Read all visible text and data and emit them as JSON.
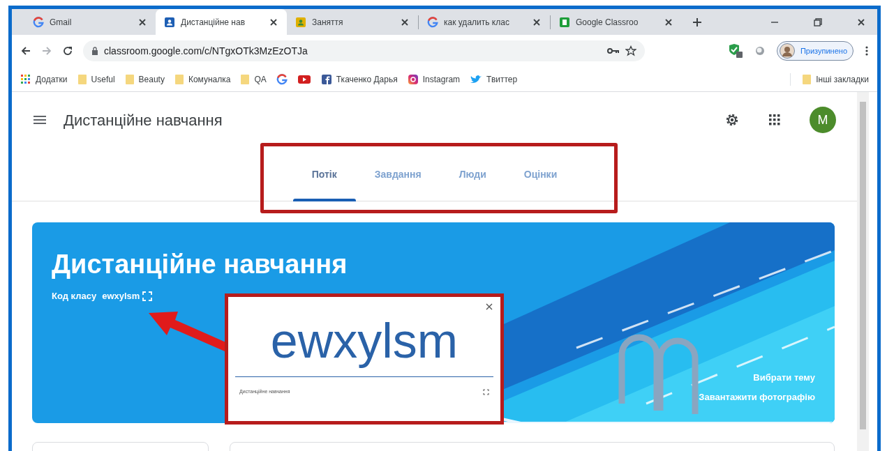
{
  "browser": {
    "tabs": [
      {
        "title": "Gmail",
        "kind": "google",
        "selected": false
      },
      {
        "title": "Дистанційне нав",
        "kind": "classroom",
        "selected": true
      },
      {
        "title": "Заняття",
        "kind": "slides",
        "selected": false
      },
      {
        "title": "как удалить клас",
        "kind": "google",
        "selected": false
      },
      {
        "title": "Google Classroo",
        "kind": "sheet",
        "selected": false
      }
    ],
    "url": "classroom.google.com/c/NTgxOTk3MzEzOTJa",
    "profile_status": "Призупинено",
    "bookmarks": [
      {
        "kind": "apps",
        "label": "Додатки"
      },
      {
        "kind": "folder",
        "label": "Useful"
      },
      {
        "kind": "folder",
        "label": "Beauty"
      },
      {
        "kind": "folder",
        "label": "Комуналка"
      },
      {
        "kind": "folder",
        "label": "QA"
      },
      {
        "kind": "google"
      },
      {
        "kind": "youtube"
      },
      {
        "kind": "facebook",
        "label": "Ткаченко Дарья"
      },
      {
        "kind": "instagram",
        "label": "Instagram"
      },
      {
        "kind": "twitter",
        "label": "Твиттер"
      }
    ],
    "other_bookmarks": "Інші закладки"
  },
  "page": {
    "class_title": "Дистанційне навчання",
    "avatar_letter": "M",
    "nav_tabs": [
      {
        "label": "Потік",
        "selected": true
      },
      {
        "label": "Завдання",
        "selected": false
      },
      {
        "label": "Люди",
        "selected": false
      },
      {
        "label": "Оцінки",
        "selected": false
      }
    ],
    "banner": {
      "title": "Дистанційне навчання",
      "code_label": "Код класу",
      "code": "ewxylsm",
      "links": [
        "Вибрати тему",
        "Завантажити фотографію"
      ]
    },
    "code_popup": {
      "code": "ewxylsm",
      "class_name": "Дистанційне навчання"
    }
  }
}
